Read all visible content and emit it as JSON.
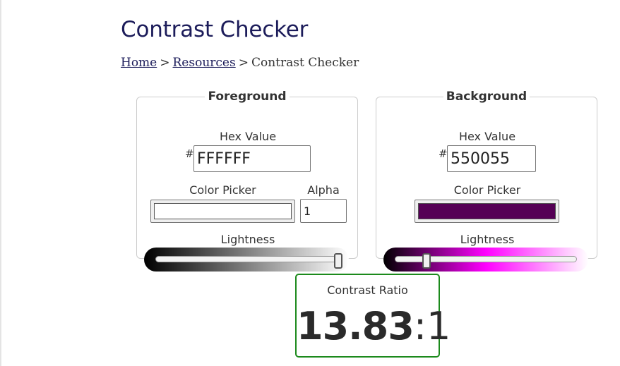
{
  "page": {
    "title": "Contrast Checker"
  },
  "breadcrumb": {
    "home": "Home",
    "sep1": ">",
    "resources": "Resources",
    "sep2": ">",
    "current": "Contrast Checker"
  },
  "foreground": {
    "legend": "Foreground",
    "hex_label": "Hex Value",
    "hash": "#",
    "hex_value": "FFFFFF",
    "picker_label": "Color Picker",
    "picker_color": "#FFFFFF",
    "alpha_label": "Alpha",
    "alpha_value": "1",
    "lightness_label": "Lightness",
    "lightness_level": 1.0,
    "gradient_colors": [
      "#000000",
      "#ffffff"
    ]
  },
  "background": {
    "legend": "Background",
    "hex_label": "Hex Value",
    "hash": "#",
    "hex_value": "550055",
    "picker_label": "Color Picker",
    "picker_color": "#550055",
    "lightness_label": "Lightness",
    "lightness_level": 0.17,
    "gradient_colors": [
      "#000000",
      "#ff00ff",
      "#ffffff"
    ]
  },
  "result": {
    "label": "Contrast Ratio",
    "ratio": "13.83",
    "separator": ":",
    "suffix": "1",
    "pass_color": "#1c8a1c"
  }
}
